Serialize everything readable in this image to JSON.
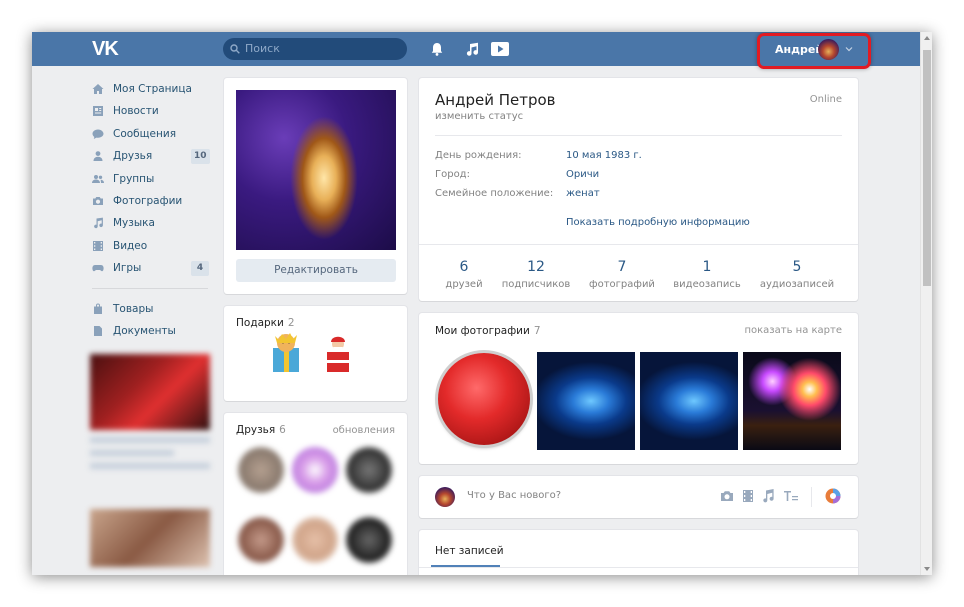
{
  "header": {
    "logo": "VK",
    "search_placeholder": "Поиск",
    "user_name": "Андрей",
    "icons": [
      "bell-icon",
      "music-icon",
      "play-icon"
    ]
  },
  "sidebar": {
    "items": [
      {
        "label": "Моя Страница",
        "icon": "home-icon"
      },
      {
        "label": "Новости",
        "icon": "news-icon"
      },
      {
        "label": "Сообщения",
        "icon": "messages-icon"
      },
      {
        "label": "Друзья",
        "icon": "friends-icon",
        "count": "10"
      },
      {
        "label": "Группы",
        "icon": "groups-icon"
      },
      {
        "label": "Фотографии",
        "icon": "camera-icon"
      },
      {
        "label": "Музыка",
        "icon": "music-note-icon"
      },
      {
        "label": "Видео",
        "icon": "video-icon"
      },
      {
        "label": "Игры",
        "icon": "gamepad-icon",
        "count": "4"
      }
    ],
    "extra": [
      {
        "label": "Товары",
        "icon": "bag-icon"
      },
      {
        "label": "Документы",
        "icon": "document-icon"
      }
    ]
  },
  "left": {
    "edit_label": "Редактировать",
    "gifts_title": "Подарки",
    "gifts_count": "2",
    "friends_title": "Друзья",
    "friends_count": "6",
    "friends_updates": "обновления"
  },
  "profile": {
    "name": "Андрей Петров",
    "status": "изменить статус",
    "online": "Online",
    "info": [
      {
        "label": "День рождения:",
        "value": "10 мая 1983 г."
      },
      {
        "label": "Город:",
        "value": "Оричи"
      },
      {
        "label": "Семейное положение:",
        "value": "женат"
      }
    ],
    "show_more": "Показать подробную информацию",
    "counters": [
      {
        "n": "6",
        "l": "друзей"
      },
      {
        "n": "12",
        "l": "подписчиков"
      },
      {
        "n": "7",
        "l": "фотографий"
      },
      {
        "n": "1",
        "l": "видеозапись"
      },
      {
        "n": "5",
        "l": "аудиозаписей"
      }
    ]
  },
  "photos": {
    "title": "Мои фотографии",
    "count": "7",
    "map_link": "показать на карте"
  },
  "post": {
    "placeholder": "Что у Вас нового?",
    "icons": [
      "camera-icon",
      "video-icon",
      "music-note-icon",
      "text-format-icon",
      "audience-icon"
    ]
  },
  "wall": {
    "tab": "Нет записей"
  },
  "colors": {
    "header": "#4a76a8",
    "link": "#2a5885",
    "highlight": "#e21b23"
  }
}
